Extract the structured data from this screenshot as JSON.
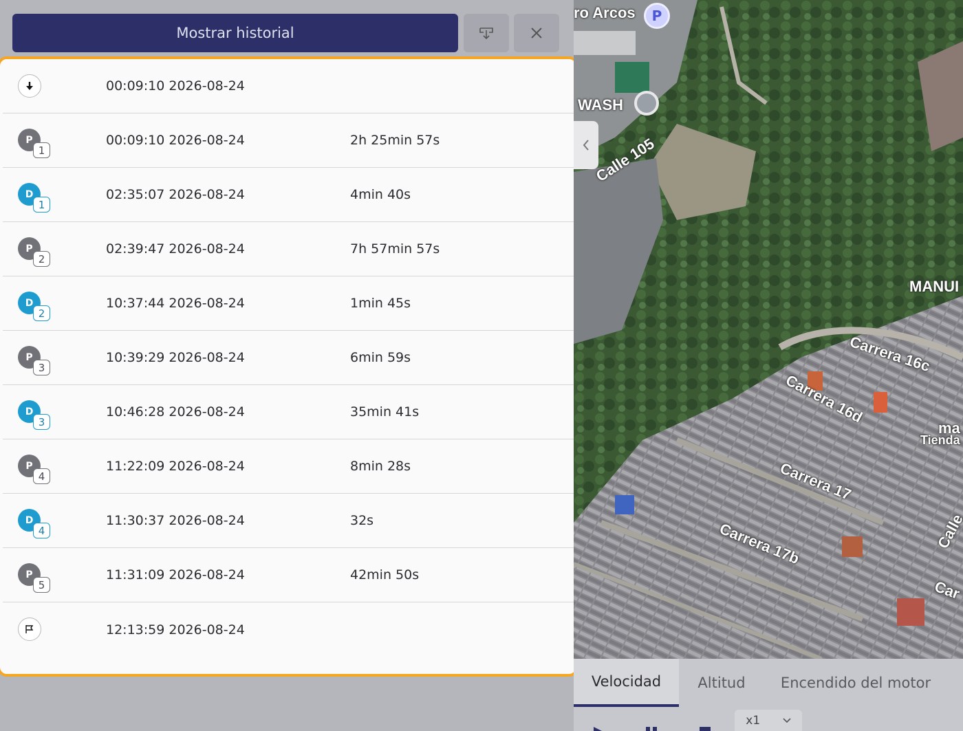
{
  "header": {
    "history_button_label": "Mostrar historial",
    "download_icon": "download-icon",
    "close_icon": "close-icon"
  },
  "colors": {
    "accent": "#2d3068",
    "highlight_border": "#f5a623",
    "parking_marker": "#717178",
    "driving_marker": "#1e9ccf"
  },
  "events": [
    {
      "type": "start",
      "icon": "arrow-down-icon",
      "time": "00:09:10 2026-08-24",
      "duration": ""
    },
    {
      "type": "P",
      "index": "1",
      "time": "00:09:10 2026-08-24",
      "duration": "2h 25min 57s"
    },
    {
      "type": "D",
      "index": "1",
      "time": "02:35:07 2026-08-24",
      "duration": "4min 40s"
    },
    {
      "type": "P",
      "index": "2",
      "time": "02:39:47 2026-08-24",
      "duration": "7h 57min 57s"
    },
    {
      "type": "D",
      "index": "2",
      "time": "10:37:44 2026-08-24",
      "duration": "1min 45s"
    },
    {
      "type": "P",
      "index": "3",
      "time": "10:39:29 2026-08-24",
      "duration": "6min 59s"
    },
    {
      "type": "D",
      "index": "3",
      "time": "10:46:28 2026-08-24",
      "duration": "35min 41s"
    },
    {
      "type": "P",
      "index": "4",
      "time": "11:22:09 2026-08-24",
      "duration": "8min 28s"
    },
    {
      "type": "D",
      "index": "4",
      "time": "11:30:37 2026-08-24",
      "duration": "32s"
    },
    {
      "type": "P",
      "index": "5",
      "time": "11:31:09 2026-08-24",
      "duration": "42min 50s"
    },
    {
      "type": "end",
      "icon": "flag-icon",
      "time": "12:13:59 2026-08-24",
      "duration": ""
    }
  ],
  "map": {
    "labels": [
      "ro Arcos",
      "WASH",
      "Calle 105",
      "MANUI",
      "Carrera 16c",
      "Carrera 16d",
      "ma",
      "Tienda",
      "Carrera 17",
      "Carrera 17b",
      "Calle",
      "Car"
    ],
    "poi_parking": "P"
  },
  "chart_tabs": {
    "tabs": [
      "Velocidad",
      "Altitud",
      "Encendido del motor"
    ],
    "active": "Velocidad"
  },
  "playback": {
    "speed_value": "x1"
  }
}
